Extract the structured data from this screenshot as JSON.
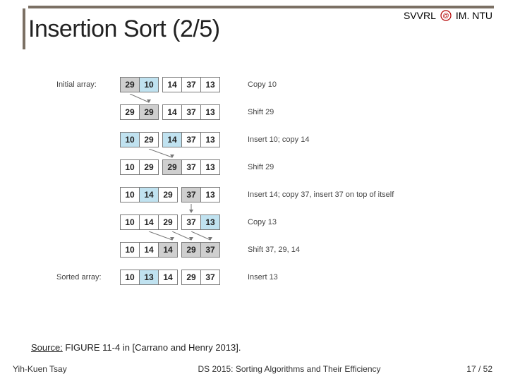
{
  "header": {
    "svvrl": "SVVRL",
    "at": "@",
    "dept": "IM. NTU"
  },
  "title": "Insertion Sort (2/5)",
  "labels": {
    "initial": "Initial array:",
    "sorted": "Sorted array:"
  },
  "steps": [
    {
      "label_key": "initial",
      "cells": [
        {
          "v": "29",
          "cls": "grey"
        },
        {
          "v": "10",
          "cls": "blue"
        },
        {
          "v": "14",
          "cls": "gap"
        },
        {
          "v": "37",
          "cls": ""
        },
        {
          "v": "13",
          "cls": ""
        }
      ],
      "caption": "Copy 10",
      "arrows": [
        {
          "from": 0,
          "to": 1
        }
      ]
    },
    {
      "cells": [
        {
          "v": "29",
          "cls": ""
        },
        {
          "v": "29",
          "cls": "grey"
        },
        {
          "v": "14",
          "cls": "gap"
        },
        {
          "v": "37",
          "cls": ""
        },
        {
          "v": "13",
          "cls": ""
        }
      ],
      "caption": "Shift 29"
    },
    {
      "cells": [
        {
          "v": "10",
          "cls": "blue"
        },
        {
          "v": "29",
          "cls": ""
        },
        {
          "v": "14",
          "cls": "blue gap"
        },
        {
          "v": "37",
          "cls": ""
        },
        {
          "v": "13",
          "cls": ""
        }
      ],
      "caption": "Insert 10; copy 14",
      "arrows": [
        {
          "from": 1,
          "to": 2
        }
      ]
    },
    {
      "cells": [
        {
          "v": "10",
          "cls": ""
        },
        {
          "v": "29",
          "cls": ""
        },
        {
          "v": "29",
          "cls": "grey gap"
        },
        {
          "v": "37",
          "cls": ""
        },
        {
          "v": "13",
          "cls": ""
        }
      ],
      "caption": "Shift 29"
    },
    {
      "cells": [
        {
          "v": "10",
          "cls": ""
        },
        {
          "v": "14",
          "cls": "blue"
        },
        {
          "v": "29",
          "cls": ""
        },
        {
          "v": "37",
          "cls": "grey gap"
        },
        {
          "v": "13",
          "cls": ""
        }
      ],
      "caption": "Insert 14; copy 37, insert 37 on top of itself",
      "arrows": [
        {
          "from": 3,
          "to": 3
        }
      ]
    },
    {
      "cells": [
        {
          "v": "10",
          "cls": ""
        },
        {
          "v": "14",
          "cls": ""
        },
        {
          "v": "29",
          "cls": ""
        },
        {
          "v": "37",
          "cls": "gap"
        },
        {
          "v": "13",
          "cls": "blue"
        }
      ],
      "caption": "Copy 13",
      "arrows": [
        {
          "from": 1,
          "to": 2
        },
        {
          "from": 2,
          "to": 3
        },
        {
          "from": 3,
          "to": 4
        }
      ]
    },
    {
      "cells": [
        {
          "v": "10",
          "cls": ""
        },
        {
          "v": "14",
          "cls": ""
        },
        {
          "v": "14",
          "cls": "grey"
        },
        {
          "v": "29",
          "cls": "grey gap"
        },
        {
          "v": "37",
          "cls": "grey"
        }
      ],
      "caption": "Shift 37, 29, 14"
    },
    {
      "label_key": "sorted",
      "cells": [
        {
          "v": "10",
          "cls": ""
        },
        {
          "v": "13",
          "cls": "blue"
        },
        {
          "v": "14",
          "cls": ""
        },
        {
          "v": "29",
          "cls": "gap"
        },
        {
          "v": "37",
          "cls": ""
        }
      ],
      "caption": "Insert 13"
    }
  ],
  "source": {
    "prefix": "Source:",
    "text": " FIGURE 11-4 in [Carrano and Henry 2013]."
  },
  "footer": {
    "author": "Yih-Kuen Tsay",
    "course": "DS 2015: Sorting Algorithms and Their Efficiency",
    "page": "17 / 52"
  }
}
